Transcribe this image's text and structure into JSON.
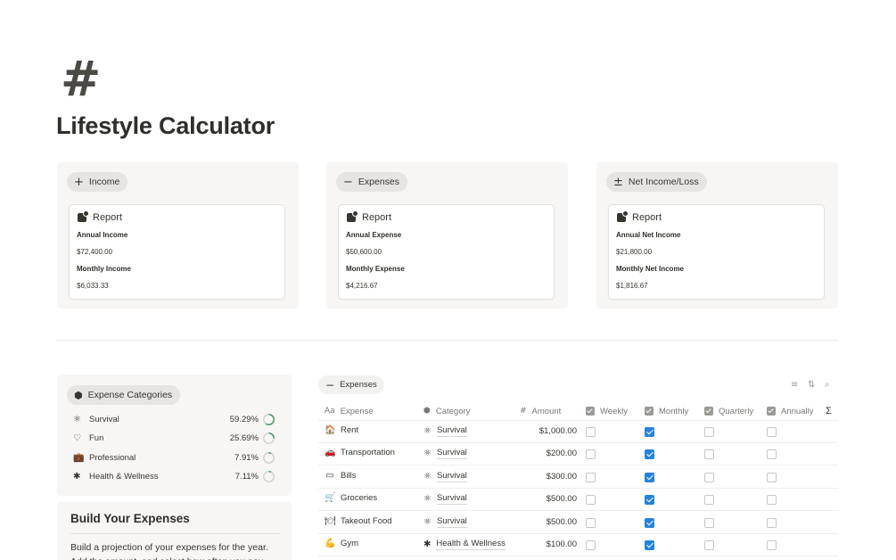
{
  "page": {
    "icon": "#",
    "title": "Lifestyle Calculator"
  },
  "cards": [
    {
      "pill_icon": "plus-icon",
      "pill_glyph": "+",
      "pill_label": "Income",
      "report_label": "Report",
      "annual_label": "Annual Income",
      "annual_value": "$72,400.00",
      "monthly_label": "Monthly Income",
      "monthly_value": "$6,033.33"
    },
    {
      "pill_icon": "minus-icon",
      "pill_glyph": "−",
      "pill_label": "Expenses",
      "report_label": "Report",
      "annual_label": "Annual Expense",
      "annual_value": "$50,600.00",
      "monthly_label": "Monthly Expense",
      "monthly_value": "$4,216.67"
    },
    {
      "pill_icon": "plus-minus-icon",
      "pill_glyph": "±",
      "pill_label": "Net Income/Loss",
      "report_label": "Report",
      "annual_label": "Annual Net Income",
      "annual_value": "$21,800.00",
      "monthly_label": "Monthly Net Income",
      "monthly_value": "$1,816.67"
    }
  ],
  "categories": {
    "pill_label": "Expense Categories",
    "items": [
      {
        "icon": "atom-icon",
        "glyph": "⚛",
        "name": "Survival",
        "percent": "59.29%",
        "fraction": 0.5929
      },
      {
        "icon": "heart-icon",
        "glyph": "♡",
        "name": "Fun",
        "percent": "25.69%",
        "fraction": 0.2569
      },
      {
        "icon": "briefcase-icon",
        "glyph": "💼",
        "name": "Professional",
        "percent": "7.91%",
        "fraction": 0.0791
      },
      {
        "icon": "asterisk-icon",
        "glyph": "✱",
        "name": "Health & Wellness",
        "percent": "7.11%",
        "fraction": 0.0711
      }
    ],
    "ring_color": "#4e9a6b"
  },
  "build": {
    "title": "Build Your Expenses",
    "text": "Build a projection of your expenses for the year. Add the amount, and select how often you pay."
  },
  "expenses_table": {
    "pill_label": "Expenses",
    "headers": {
      "expense": "Expense",
      "category": "Category",
      "amount": "Amount",
      "weekly": "Weekly",
      "monthly": "Monthly",
      "quarterly": "Quarterly",
      "annually": "Annually",
      "sum": "Σ"
    },
    "rows": [
      {
        "icon": "home-icon",
        "glyph": "🏠",
        "expense": "Rent",
        "category": "Survival",
        "category_glyph": "⚛",
        "amount": "$1,000.00",
        "weekly": false,
        "monthly": true,
        "quarterly": false,
        "annually": false
      },
      {
        "icon": "car-icon",
        "glyph": "🚗",
        "expense": "Transportation",
        "category": "Survival",
        "category_glyph": "⚛",
        "amount": "$200.00",
        "weekly": false,
        "monthly": true,
        "quarterly": false,
        "annually": false
      },
      {
        "icon": "bills-icon",
        "glyph": "▭",
        "expense": "Bills",
        "category": "Survival",
        "category_glyph": "⚛",
        "amount": "$300.00",
        "weekly": false,
        "monthly": true,
        "quarterly": false,
        "annually": false
      },
      {
        "icon": "cart-icon",
        "glyph": "🛒",
        "expense": "Groceries",
        "category": "Survival",
        "category_glyph": "⚛",
        "amount": "$500.00",
        "weekly": false,
        "monthly": true,
        "quarterly": false,
        "annually": false
      },
      {
        "icon": "food-icon",
        "glyph": "🍽",
        "expense": "Takeout Food",
        "category": "Survival",
        "category_glyph": "⚛",
        "amount": "$500.00",
        "weekly": false,
        "monthly": true,
        "quarterly": false,
        "annually": false
      },
      {
        "icon": "gym-icon",
        "glyph": "💪",
        "expense": "Gym",
        "category": "Health & Wellness",
        "category_glyph": "✱",
        "amount": "$100.00",
        "weekly": false,
        "monthly": true,
        "quarterly": false,
        "annually": false
      }
    ]
  }
}
